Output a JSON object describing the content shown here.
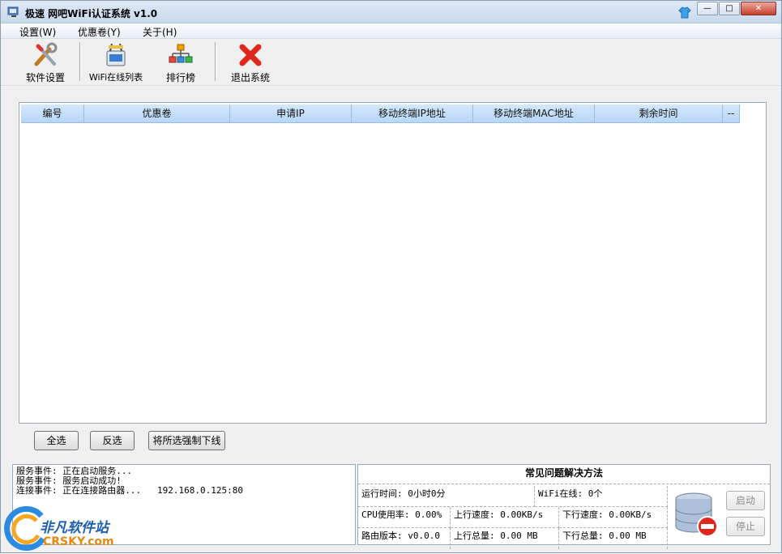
{
  "window": {
    "title": "极速 网吧WiFi认证系统 v1.0",
    "controls": {
      "minimize": "—",
      "maximize": "□",
      "close": "✕"
    }
  },
  "menu": {
    "items": [
      "设置(W)",
      "优惠卷(Y)",
      "关于(H)"
    ]
  },
  "toolbar": {
    "items": [
      {
        "label": "软件设置",
        "icon": "tools-icon"
      },
      {
        "label": "WiFi在线列表",
        "icon": "router-icon"
      },
      {
        "label": "排行榜",
        "icon": "hierarchy-icon"
      },
      {
        "label": "退出系统",
        "icon": "exit-x-icon"
      }
    ]
  },
  "table": {
    "columns": [
      "编号",
      "优惠卷",
      "申请IP",
      "移动终端IP地址",
      "移动终端MAC地址",
      "剩余时间",
      "--"
    ],
    "rows": []
  },
  "actions": {
    "select_all": "全选",
    "invert": "反选",
    "force_offline": "将所选强制下线"
  },
  "log": {
    "lines": [
      "服务事件: 正在启动服务...",
      "服务事件: 服务启动成功!",
      "连接事件: 正在连接路由器...   192.168.0.125:80"
    ]
  },
  "status": {
    "faq_title": "常见问题解决方法",
    "run_time": "运行时间: 0小时0分",
    "wifi_online": "WiFi在线: 0个",
    "cpu": "CPU使用率: 0.00%",
    "up_speed": "上行速度: 0.00KB/s",
    "down_speed": "下行速度: 0.00KB/s",
    "router_version": "路由版本: v0.0.0",
    "up_total": "上行总量: 0.00 MB",
    "down_total": "下行总量: 0.00 MB",
    "start_button": "启动",
    "stop_button": "停止"
  },
  "watermark": {
    "cn": "非凡软件站",
    "en": "CRSKY.com"
  },
  "colors": {
    "header_blue": "#b7d6f6",
    "close_red": "#c6402b",
    "exit_red": "#e0271e"
  }
}
